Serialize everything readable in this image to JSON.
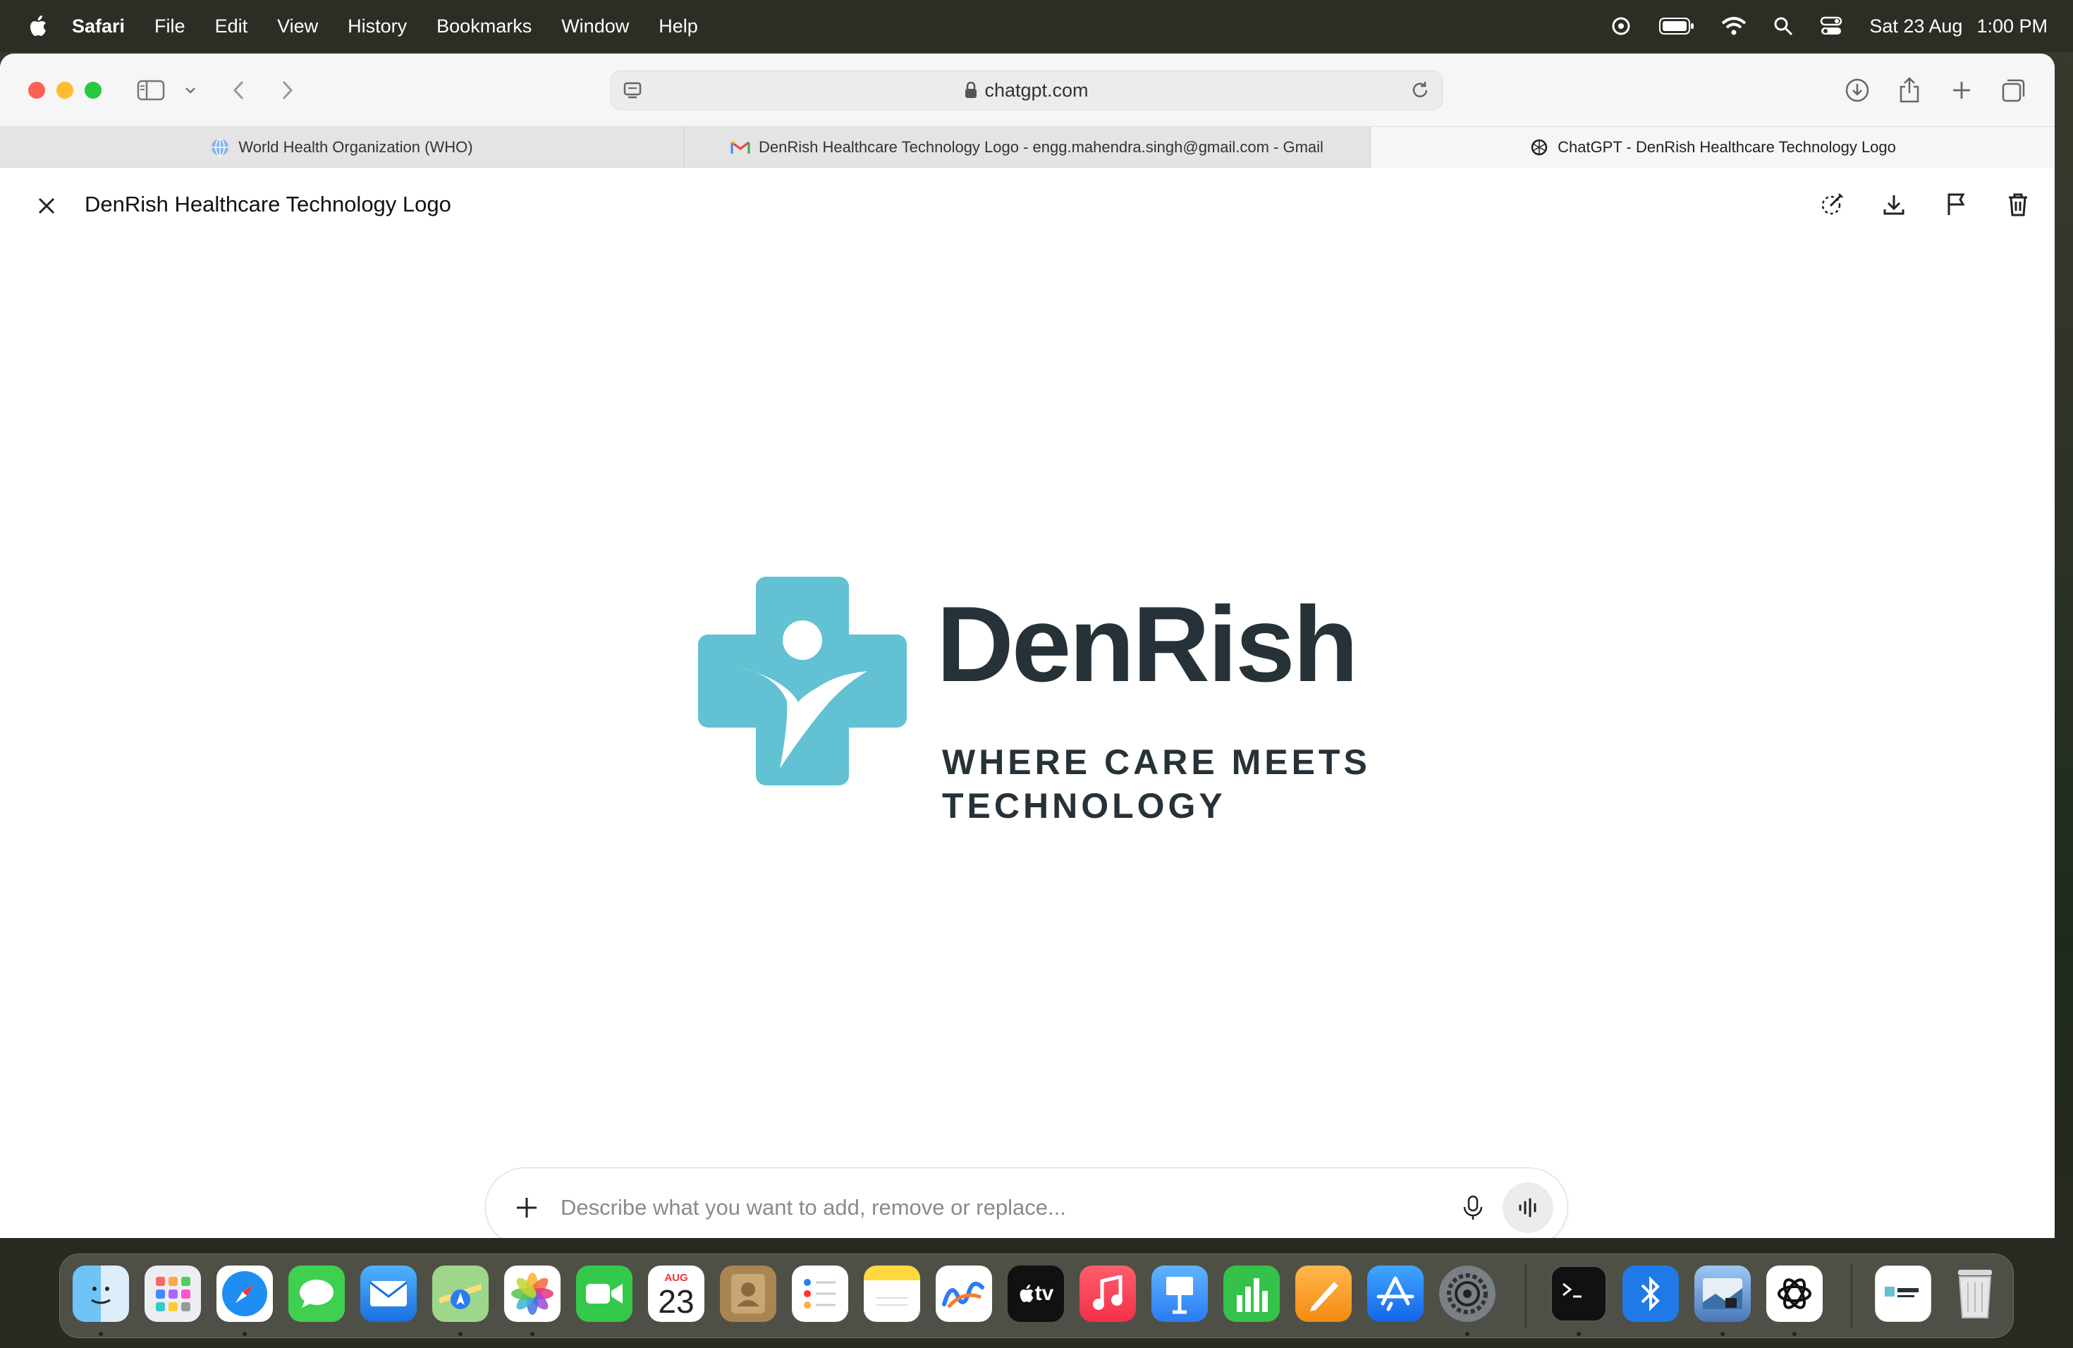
{
  "menubar": {
    "app_name": "Safari",
    "items": [
      "File",
      "Edit",
      "View",
      "History",
      "Bookmarks",
      "Window",
      "Help"
    ],
    "date": "Sat 23 Aug",
    "time": "1:00 PM",
    "status_icons": [
      "chatgpt-icon",
      "battery-icon",
      "wifi-icon",
      "spotlight-icon",
      "control-center-icon"
    ]
  },
  "browser": {
    "url": "chatgpt.com",
    "tabs": [
      {
        "title": "World Health Organization (WHO)",
        "icon": "who-globe-icon"
      },
      {
        "title": "DenRish Healthcare Technology Logo - engg.mahendra.singh@gmail.com - Gmail",
        "icon": "gmail-icon"
      },
      {
        "title": "ChatGPT - DenRish Healthcare Technology Logo",
        "icon": "chatgpt-icon",
        "active": true
      }
    ]
  },
  "page": {
    "title": "DenRish Healthcare Technology Logo",
    "actions": [
      "select-edit-icon",
      "download-icon",
      "flag-icon",
      "trash-icon"
    ]
  },
  "logo": {
    "name": "DenRish",
    "tagline": "WHERE CARE MEETS TECHNOLOGY",
    "mark_color": "#62c1d3",
    "text_color": "#263238"
  },
  "prompt": {
    "placeholder": "Describe what you want to add, remove or replace..."
  },
  "dock": {
    "calendar_month": "AUG",
    "calendar_day": "23",
    "tv_label": "tv"
  }
}
